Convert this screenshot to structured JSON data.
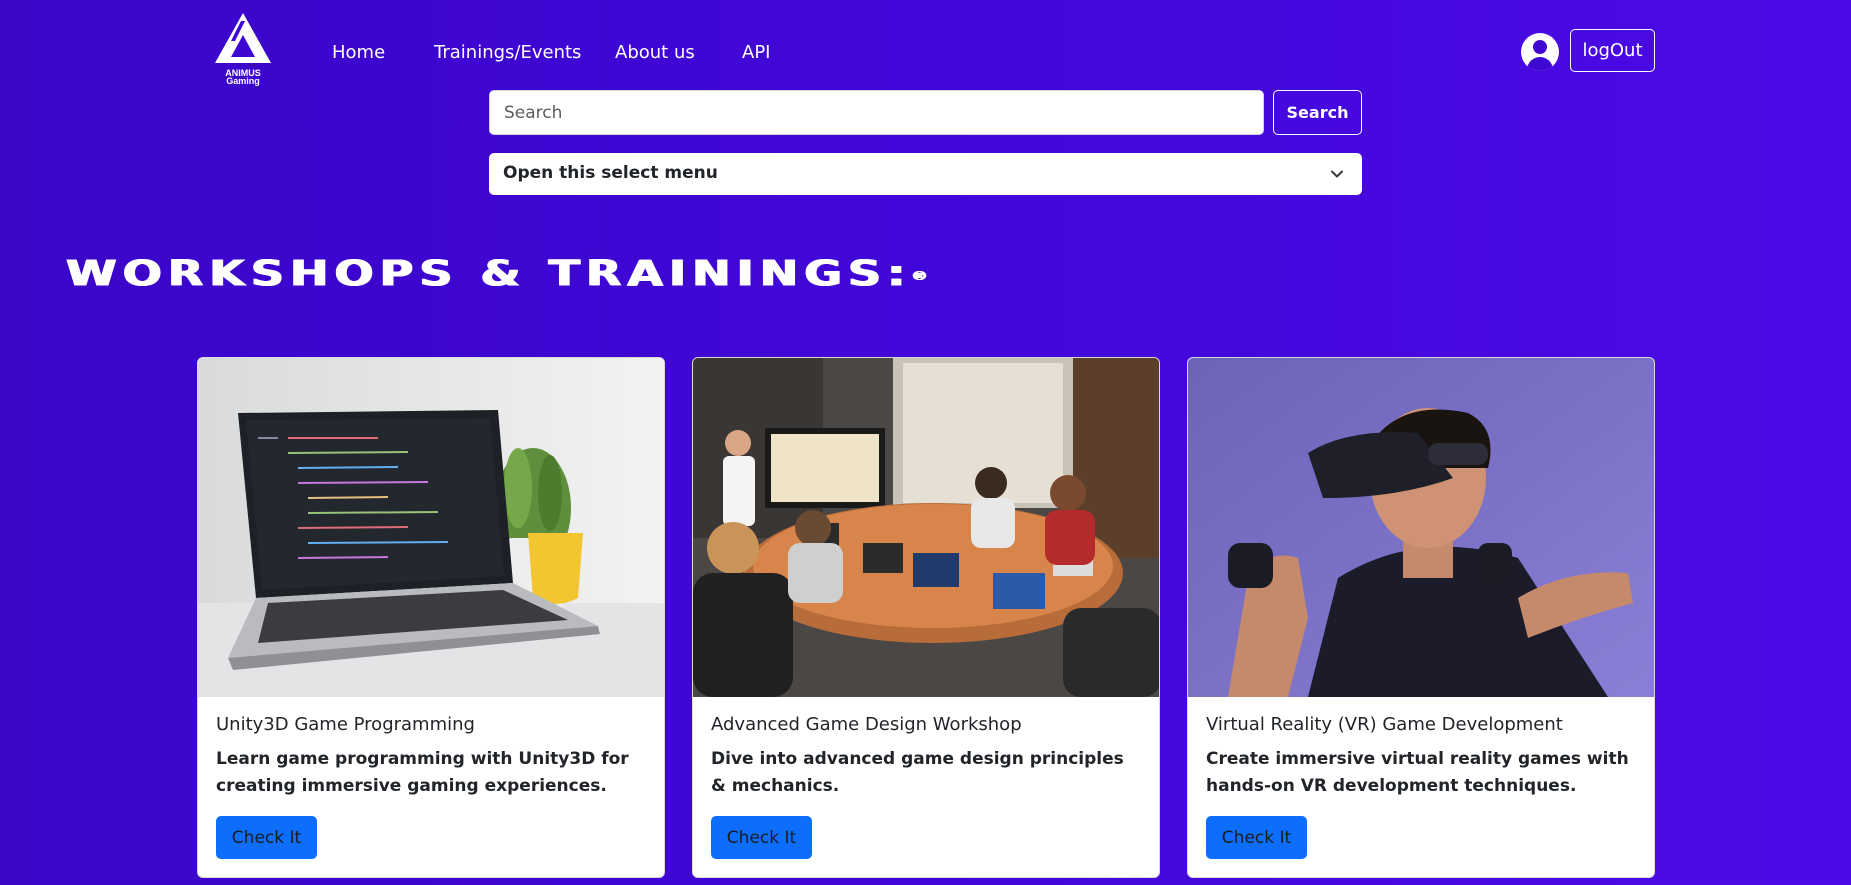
{
  "nav": {
    "logo_line1": "ANIMUS",
    "logo_line2": "Gaming",
    "links": [
      "Home",
      "Trainings/Events",
      "About us",
      "API"
    ],
    "logout_label": "logOut"
  },
  "search": {
    "placeholder": "Search",
    "button_label": "Search",
    "select_label": "Open this select menu"
  },
  "section": {
    "heading": "Workshops & Trainings:",
    "reg_mark": "®"
  },
  "cards": [
    {
      "title": "Unity3D Game Programming",
      "text": "Learn game programming with Unity3D for creating immersive gaming experiences.",
      "button": "Check It",
      "image": "laptop-code-photo"
    },
    {
      "title": "Advanced Game Design Workshop",
      "text": "Dive into advanced game design principles & mechanics.",
      "button": "Check It",
      "image": "workshop-meeting-photo"
    },
    {
      "title": "Virtual Reality (VR) Game Development",
      "text": "Create immersive virtual reality games with hands-on VR development techniques.",
      "button": "Check It",
      "image": "vr-headset-photo"
    }
  ],
  "colors": {
    "background": "#4107d8",
    "primary_button": "#0d6efd",
    "card": "#ffffff"
  }
}
